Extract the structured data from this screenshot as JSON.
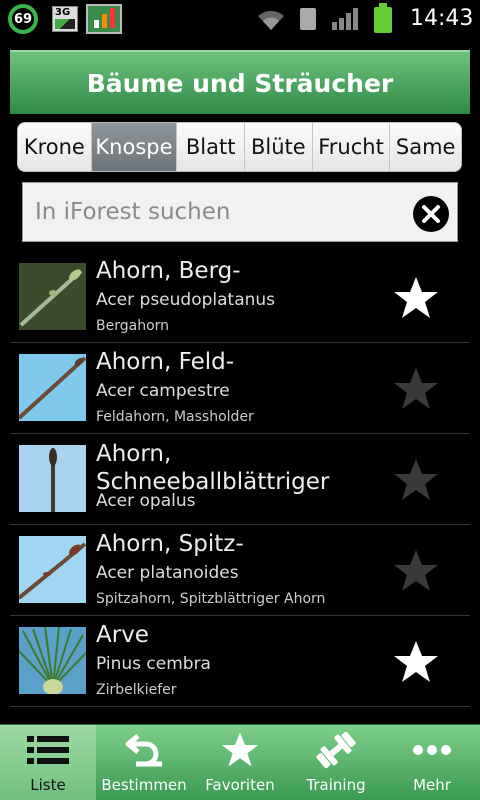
{
  "status": {
    "battery_level": "69",
    "network": "3G",
    "time": "14:43"
  },
  "header": {
    "title": "Bäume und Sträucher"
  },
  "tabs": [
    {
      "label": "Krone",
      "active": false
    },
    {
      "label": "Knospe",
      "active": true
    },
    {
      "label": "Blatt",
      "active": false
    },
    {
      "label": "Blüte",
      "active": false
    },
    {
      "label": "Frucht",
      "active": false
    },
    {
      "label": "Same",
      "active": false
    }
  ],
  "search": {
    "placeholder": "In iForest suchen"
  },
  "items": [
    {
      "name": "Ahorn, Berg-",
      "latin": "Acer pseudoplatanus",
      "common": "Bergahorn",
      "favorite": true
    },
    {
      "name": "Ahorn, Feld-",
      "latin": "Acer campestre",
      "common": "Feldahorn, Massholder",
      "favorite": false
    },
    {
      "name": "Ahorn, Schneeballblättriger",
      "latin": "Acer opalus",
      "common": "",
      "favorite": false
    },
    {
      "name": "Ahorn, Spitz-",
      "latin": "Acer platanoides",
      "common": "Spitzahorn, Spitzblättriger Ahorn",
      "favorite": false
    },
    {
      "name": "Arve",
      "latin": "Pinus cembra",
      "common": "Zirbelkiefer",
      "favorite": true
    }
  ],
  "nav": [
    {
      "label": "Liste",
      "icon": "list-icon",
      "active": true
    },
    {
      "label": "Bestimmen",
      "icon": "identify-icon",
      "active": false
    },
    {
      "label": "Favoriten",
      "icon": "star-icon",
      "active": false
    },
    {
      "label": "Training",
      "icon": "dumbbell-icon",
      "active": false
    },
    {
      "label": "Mehr",
      "icon": "more-icon",
      "active": false
    }
  ],
  "colors": {
    "header_green": "#2e8a45",
    "nav_green": "#5cb56b",
    "star_on": "#ffffff",
    "star_off": "#3a3a3a"
  }
}
